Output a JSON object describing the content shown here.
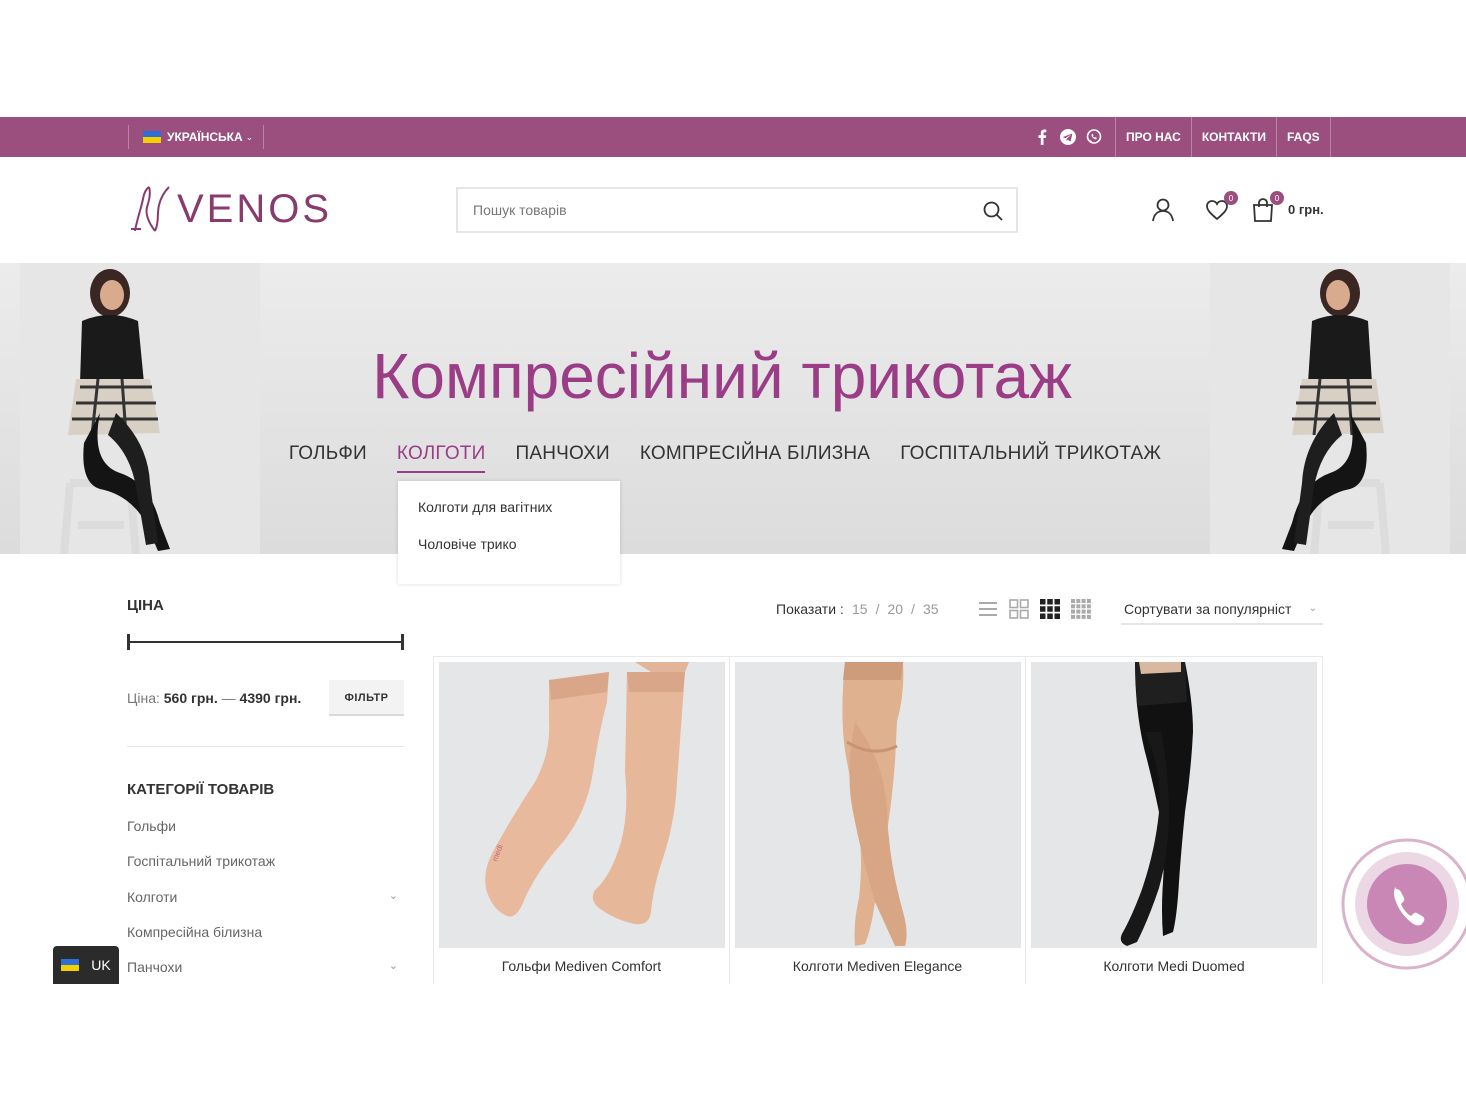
{
  "topbar": {
    "language": "УКРАЇНСЬКА",
    "links": [
      "ПРО НАС",
      "КОНТАКТИ",
      "FAQS"
    ]
  },
  "header": {
    "logo_text": "VENOS",
    "search_placeholder": "Пошук товарів",
    "wishlist_count": "0",
    "cart_count": "0",
    "cart_total": "0 грн."
  },
  "hero": {
    "title": "Компресійний трикотаж",
    "nav": [
      "ГОЛЬФИ",
      "КОЛГОТИ",
      "ПАНЧОХИ",
      "КОМПРЕСІЙНА БІЛИЗНА",
      "ГОСПІТАЛЬНИЙ ТРИКОТАЖ"
    ],
    "active_nav": "КОЛГОТИ",
    "dropdown": [
      "Колготи для вагітних",
      "Чоловіче трико"
    ]
  },
  "sidebar": {
    "price_title": "ЦІНА",
    "price_label": "Ціна:",
    "price_min": "560 грн.",
    "price_sep": "—",
    "price_max": "4390 грн.",
    "filter_button": "ФІЛЬТР",
    "categories_title": "КАТЕГОРІЇ ТОВАРІВ",
    "categories": [
      {
        "label": "Гольфи",
        "has_children": false
      },
      {
        "label": "Госпітальний трикотаж",
        "has_children": false
      },
      {
        "label": "Колготи",
        "has_children": true
      },
      {
        "label": "Компресійна білизна",
        "has_children": false
      },
      {
        "label": "Панчохи",
        "has_children": true
      }
    ]
  },
  "toolbar": {
    "show_label": "Показати :",
    "show_options": [
      "15",
      "/",
      "20",
      "/",
      "35"
    ],
    "sort_label": "Сортувати за популярніст"
  },
  "products": [
    {
      "name": "Гольфи Mediven Comfort"
    },
    {
      "name": "Колготи Mediven Elegance"
    },
    {
      "name": "Колготи Medi Duomed"
    }
  ],
  "floating": {
    "lang_pill": "UK"
  },
  "colors": {
    "brand": "#9b4f7f",
    "hero_title": "#9b3d86"
  }
}
